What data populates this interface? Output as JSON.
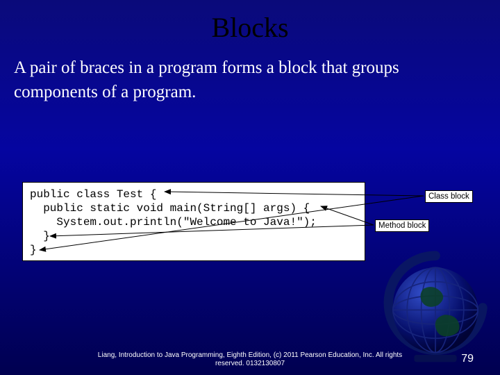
{
  "title": "Blocks",
  "body": "A pair of braces in a program forms a block that groups components of a program.",
  "code": {
    "line1": "public class Test {",
    "line2": "  public static void main(String[] args) {",
    "line3": "    System.out.println(\"Welcome to Java!\");",
    "line4": "  }",
    "line5": "}"
  },
  "labels": {
    "class_block": "Class block",
    "method_block": "Method block"
  },
  "footer": "Liang, Introduction to Java Programming, Eighth Edition, (c) 2011 Pearson Education, Inc. All rights reserved. 0132130807",
  "page_number": "79"
}
